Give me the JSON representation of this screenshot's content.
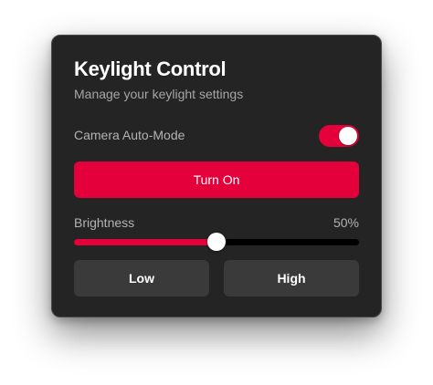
{
  "header": {
    "title": "Keylight Control",
    "subtitle": "Manage your keylight settings"
  },
  "camera_auto_mode": {
    "label": "Camera Auto-Mode",
    "enabled": true
  },
  "power_button": {
    "label": "Turn On"
  },
  "brightness": {
    "label": "Brightness",
    "value_text": "50%",
    "level": 0.5
  },
  "presets": {
    "low_label": "Low",
    "high_label": "High"
  },
  "colors": {
    "accent": "#e4003a",
    "panel_background": "#242424",
    "secondary_button": "#3a3a3a",
    "slider_track": "#000000"
  }
}
